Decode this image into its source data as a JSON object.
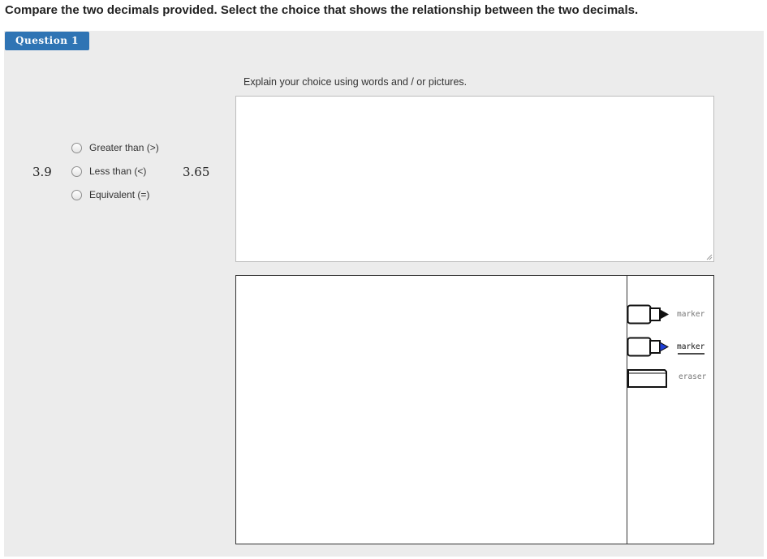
{
  "instruction": "Compare the two decimals provided. Select the choice that shows the relationship between the two decimals.",
  "question_tab": "Question 1",
  "decimals": {
    "left": "3.9",
    "right": "3.65"
  },
  "choices": [
    {
      "label": "Greater than (>)",
      "selected": false
    },
    {
      "label": "Less than (<)",
      "selected": false
    },
    {
      "label": "Equivalent (=)",
      "selected": false
    }
  ],
  "explain": {
    "label": "Explain your choice using words and / or pictures.",
    "value": ""
  },
  "tools": [
    {
      "label": "marker",
      "icon": "black-marker-icon",
      "color": "#111111"
    },
    {
      "label": "marker",
      "icon": "blue-marker-icon",
      "color": "#1f3fd8"
    },
    {
      "label": "eraser",
      "icon": "eraser-icon",
      "color": "#ffffff"
    }
  ],
  "colors": {
    "tab_accent": "#2f74b4",
    "panel_bg": "#ececec"
  }
}
